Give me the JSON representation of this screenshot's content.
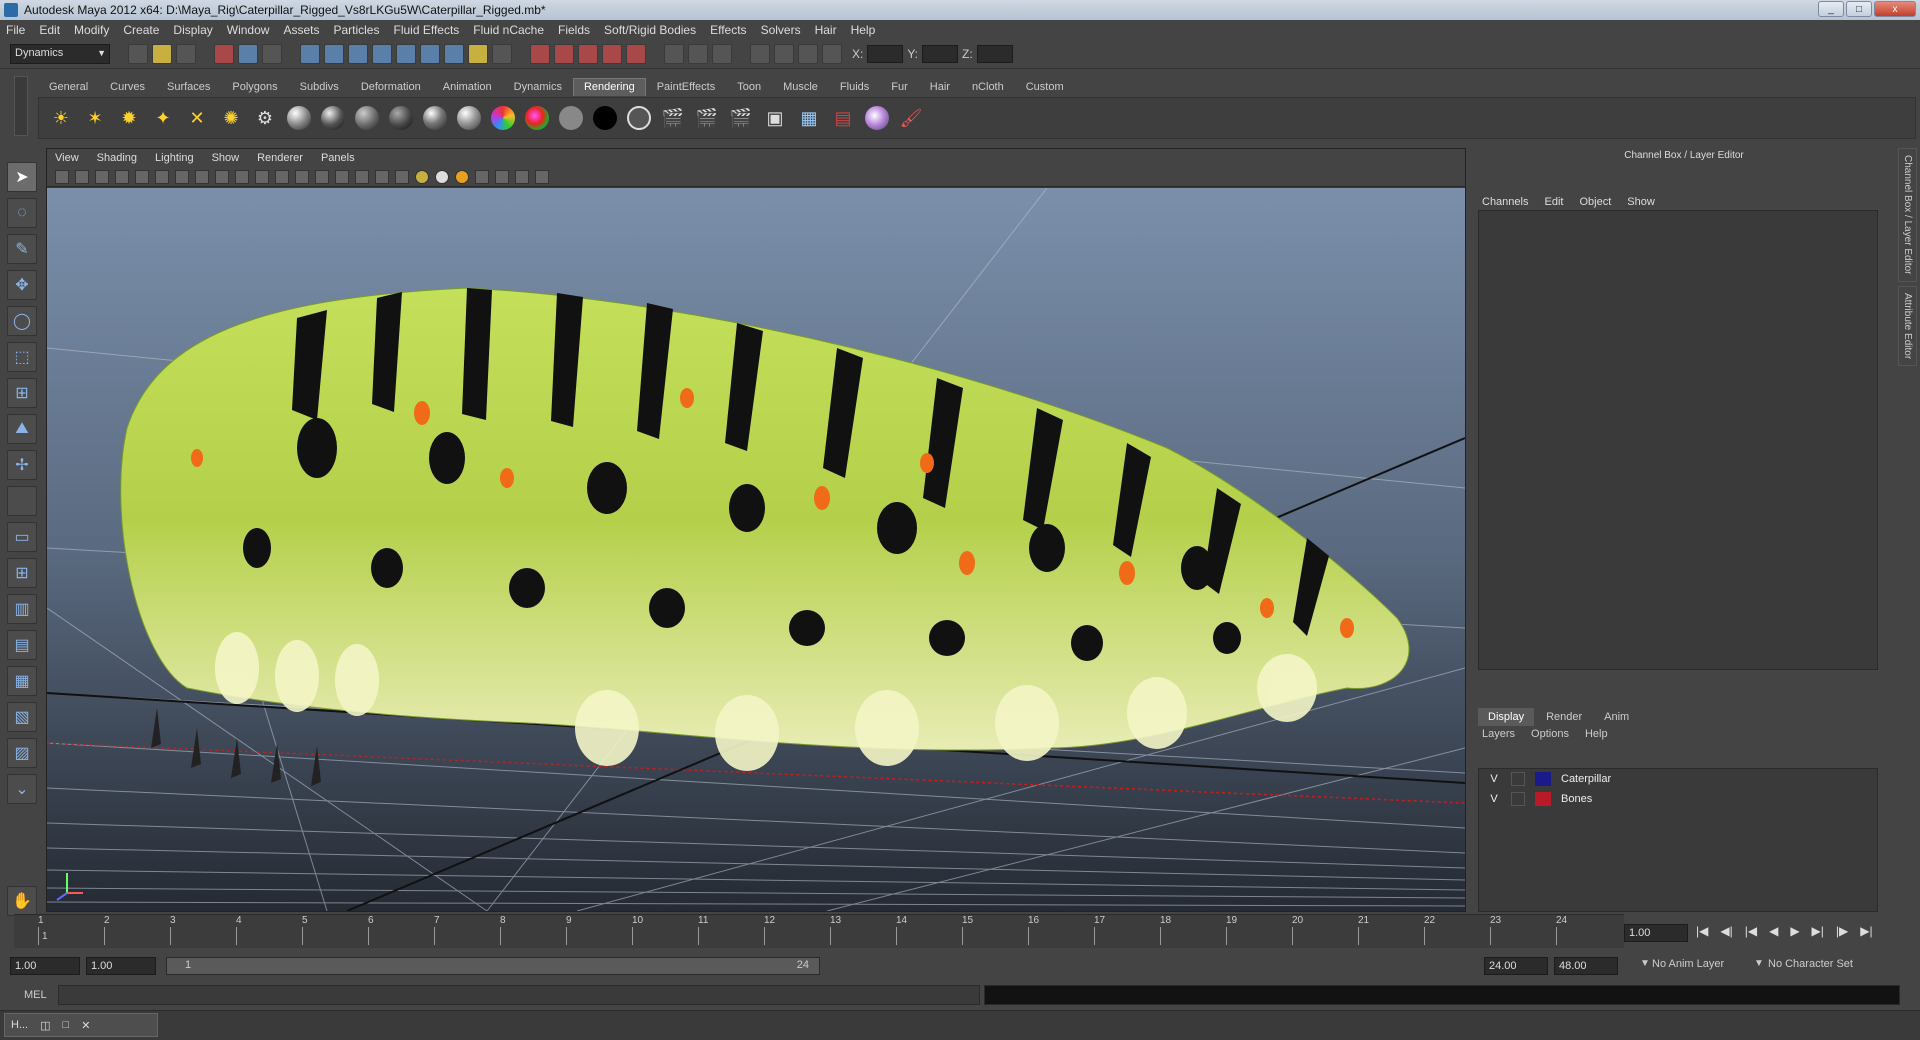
{
  "window": {
    "title": "Autodesk Maya 2012 x64: D:\\Maya_Rig\\Caterpillar_Rigged_Vs8rLKGu5W\\Caterpillar_Rigged.mb*",
    "minimize": "_",
    "maximize": "□",
    "close": "x"
  },
  "menubar": [
    "File",
    "Edit",
    "Modify",
    "Create",
    "Display",
    "Window",
    "Assets",
    "Particles",
    "Fluid Effects",
    "Fluid nCache",
    "Fields",
    "Soft/Rigid Bodies",
    "Effects",
    "Solvers",
    "Hair",
    "Help"
  ],
  "statusline": {
    "menu_set": "Dynamics",
    "x_label": "X:",
    "y_label": "Y:",
    "z_label": "Z:"
  },
  "shelf": {
    "tabs": [
      "General",
      "Curves",
      "Surfaces",
      "Polygons",
      "Subdivs",
      "Deformation",
      "Animation",
      "Dynamics",
      "Rendering",
      "PaintEffects",
      "Toon",
      "Muscle",
      "Fluids",
      "Fur",
      "Hair",
      "nCloth",
      "Custom"
    ],
    "active_tab": "Rendering"
  },
  "viewport": {
    "menu": [
      "View",
      "Shading",
      "Lighting",
      "Show",
      "Renderer",
      "Panels"
    ]
  },
  "channel_box": {
    "title": "Channel Box / Layer Editor",
    "menu": [
      "Channels",
      "Edit",
      "Object",
      "Show"
    ]
  },
  "layer_editor": {
    "tabs": [
      "Display",
      "Render",
      "Anim"
    ],
    "active_tab": "Display",
    "menu": [
      "Layers",
      "Options",
      "Help"
    ],
    "layers": [
      {
        "visible": "V",
        "name": "Caterpillar",
        "color": "#1a1a8a"
      },
      {
        "visible": "V",
        "name": "Bones",
        "color": "#b81a2a"
      }
    ]
  },
  "side_tabs": [
    "Channel Box / Layer Editor",
    "Attribute Editor"
  ],
  "time_slider": {
    "frames": [
      "1",
      "2",
      "3",
      "4",
      "5",
      "6",
      "7",
      "8",
      "9",
      "10",
      "11",
      "12",
      "13",
      "14",
      "15",
      "16",
      "17",
      "18",
      "19",
      "20",
      "21",
      "22",
      "23",
      "24"
    ],
    "current_marker": "1",
    "current_frame": "1.00"
  },
  "range_slider": {
    "start_time": "1.00",
    "playback_start": "1.00",
    "range_start_label": "1",
    "range_end_label": "24",
    "playback_end": "24.00",
    "end_time": "48.00",
    "anim_layer": "No Anim Layer",
    "character_set": "No Character Set"
  },
  "command_line": {
    "label": "MEL"
  },
  "taskbar": {
    "item_label": "H..."
  }
}
